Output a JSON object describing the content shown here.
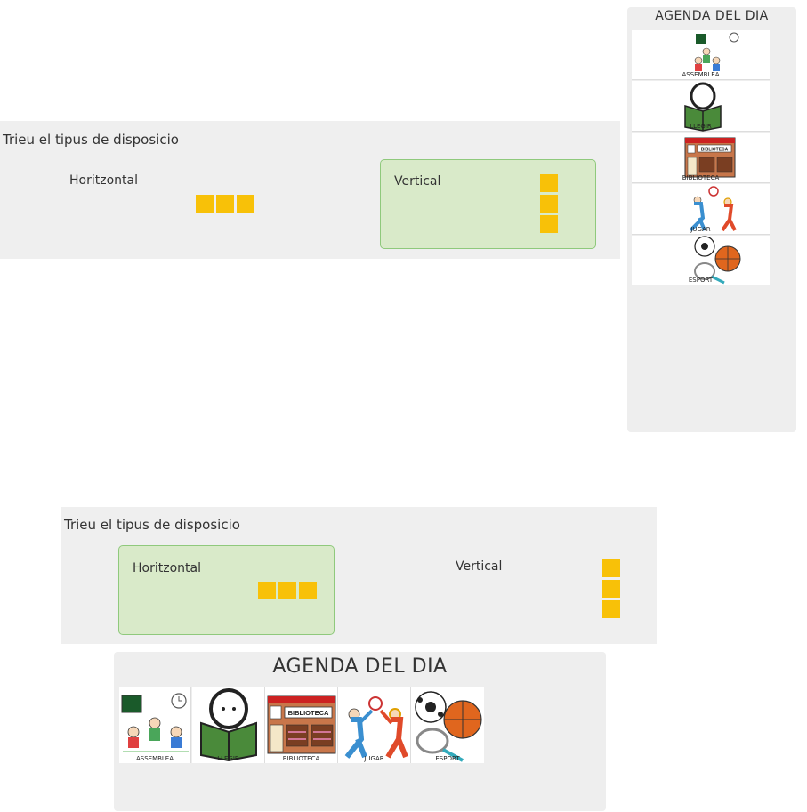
{
  "layout_top": {
    "title": "Trieu el tipus de disposicio",
    "options": [
      {
        "label": "Horitzontal",
        "selected": false
      },
      {
        "label": "Vertical",
        "selected": true
      }
    ]
  },
  "layout_bottom": {
    "title": "Trieu el tipus de disposicio",
    "options": [
      {
        "label": "Horitzontal",
        "selected": true
      },
      {
        "label": "Vertical",
        "selected": false
      }
    ]
  },
  "agenda_vertical": {
    "title": "AGENDA DEL DIA",
    "items": [
      {
        "label": "ASSEMBLEA",
        "icon": "assembly-icon"
      },
      {
        "label": "LLEGIR",
        "icon": "reading-icon"
      },
      {
        "label": "BIBLIOTECA",
        "icon": "library-icon",
        "sign": "BIBLIOTECA"
      },
      {
        "label": "JUGAR",
        "icon": "playing-icon"
      },
      {
        "label": "ESPORT",
        "icon": "sport-icon"
      }
    ]
  },
  "agenda_horizontal": {
    "title": "AGENDA DEL DIA",
    "items": [
      {
        "label": "ASSEMBLEA",
        "icon": "assembly-icon"
      },
      {
        "label": "LLEGIR",
        "icon": "reading-icon"
      },
      {
        "label": "BIBLIOTECA",
        "icon": "library-icon",
        "sign": "BIBLIOTECA"
      },
      {
        "label": "JUGAR",
        "icon": "playing-icon"
      },
      {
        "label": "ESPORT",
        "icon": "sport-icon"
      }
    ]
  },
  "colors": {
    "selected_bg": "#d9eac9",
    "selected_border": "#8fc97c",
    "square": "#f8c108",
    "rule": "#5b86c3"
  }
}
